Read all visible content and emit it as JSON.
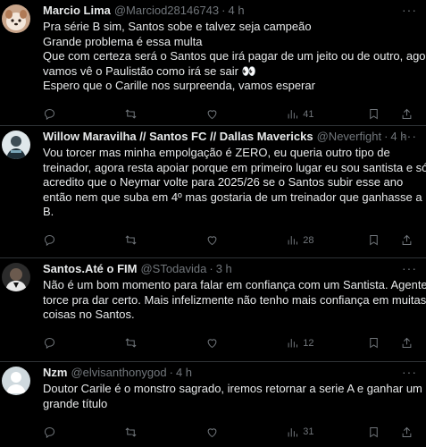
{
  "tweets": [
    {
      "name": "Marcio Lima",
      "handle": "@Marciod28146743",
      "time": "4 h",
      "lines": [
        "Pra série B sim, Santos sobe e talvez seja campeão",
        "Grande problema é essa multa",
        "Que com certeza será o Santos que irá pagar de um jeito ou de outro, agora",
        "vamos vê o Paulistão como irá se sair 👀",
        "Espero que o Carille nos surpreenda, vamos esperar"
      ],
      "views": "41"
    },
    {
      "name": "Willow Maravilha // Santos FC // Dallas Mavericks",
      "handle": "@Neverfight",
      "time": "4 h",
      "lines": [
        "Vou torcer mas minha empolgação é ZERO, eu queria outro tipo de",
        "treinador, agora resta apoiar porque em primeiro lugar eu sou santista e só",
        "acredito que o Neymar volte para 2025/26 se o Santos subir esse ano",
        "então nem que suba em 4º mas gostaria de um treinador que ganhasse a",
        "B."
      ],
      "views": "28"
    },
    {
      "name": "Santos.Até o FIM",
      "handle": "@STodavida",
      "time": "3 h",
      "lines": [
        "Não é um bom momento para falar em confiança com um Santista. Agente",
        "torce pra dar certo. Mais infelizmente não tenho mais confiança em muitas",
        "coisas no Santos."
      ],
      "views": "12"
    },
    {
      "name": "Nzm",
      "handle": "@elvisanthonygod",
      "time": "4 h",
      "lines": [
        "Doutor Carile é o monstro sagrado,  iremos retornar a serie A e ganhar um",
        "grande título"
      ],
      "views": "31"
    }
  ],
  "icons": {
    "reply": "reply-icon",
    "retweet": "retweet-icon",
    "like": "like-icon",
    "views": "views-icon",
    "bookmark": "bookmark-icon",
    "share": "share-icon",
    "more": "more-icon"
  },
  "colors": {
    "background": "#000000",
    "text": "#e7e9ea",
    "muted": "#71767b",
    "border": "#2f3336"
  }
}
